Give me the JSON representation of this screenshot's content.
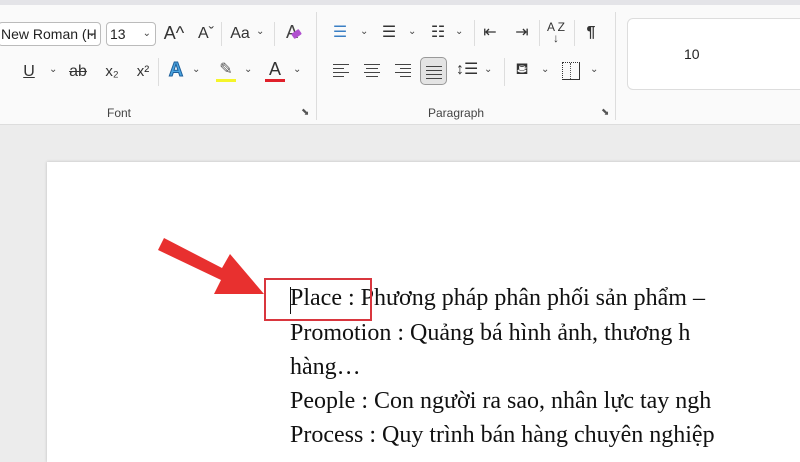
{
  "ribbon": {
    "font": {
      "font_name": "New Roman (H",
      "font_size": "13",
      "grow_font": "A^",
      "shrink_font": "Aˇ",
      "change_case": "Aa",
      "underline": "U",
      "strikethrough": "ab",
      "subscript": "x₂",
      "superscript": "x²",
      "text_effects": "A",
      "font_color": "A",
      "group_label": "Font",
      "highlight_color": "#f5f52a",
      "font_color_value": "#e0202a"
    },
    "paragraph": {
      "sort": "A Z ↓",
      "pilcrow": "¶",
      "group_label": "Paragraph",
      "active_alignment": "justify"
    },
    "styles": {
      "preview_text": "10"
    }
  },
  "document": {
    "lines": [
      {
        "label": "Place :",
        "text": " Phương pháp phân phối sản phẩm –"
      },
      {
        "text": "Promotion : Quảng bá hình ảnh, thương h"
      },
      {
        "text": "hàng…"
      },
      {
        "text": "People : Con người ra sao, nhân lực tay ngh"
      },
      {
        "text": "Process : Quy trình bán hàng chuyên nghiệp"
      }
    ]
  },
  "annotation": {
    "color": "#e8302f"
  }
}
